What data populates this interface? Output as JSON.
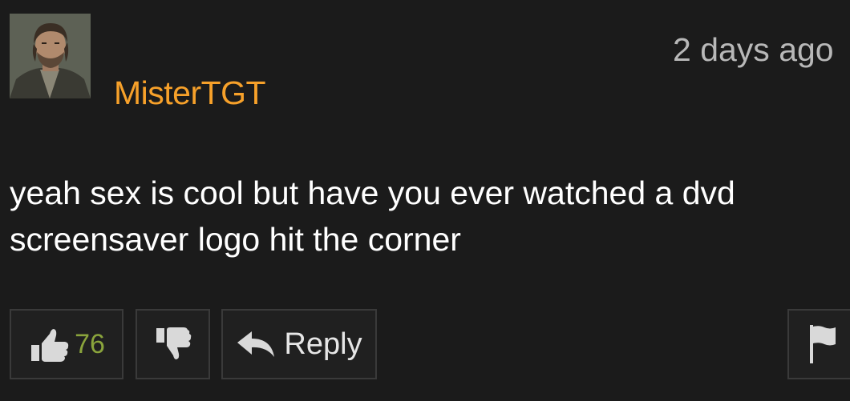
{
  "comment": {
    "username": "MisterTGT",
    "timestamp": "2 days ago",
    "body_line1": "yeah sex is cool but have you ever watched a dvd",
    "body_line2": "screensaver logo hit the corner",
    "like_count": "76",
    "reply_label": "Reply"
  },
  "icons": {
    "like": "thumbs-up-icon",
    "dislike": "thumbs-down-icon",
    "reply": "reply-arrow-icon",
    "flag": "flag-icon"
  },
  "colors": {
    "background": "#1b1b1b",
    "username": "#f7a12a",
    "like_count": "#8aa43c",
    "timestamp": "#b8b8b8",
    "body_text": "#ffffff"
  }
}
